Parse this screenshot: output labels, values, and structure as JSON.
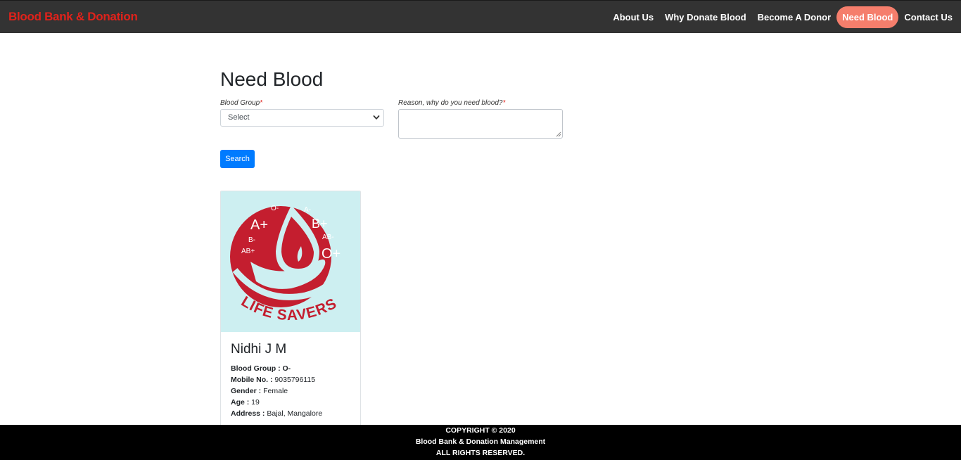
{
  "navbar": {
    "brand": "Blood Bank & Donation",
    "links": [
      {
        "label": "About Us"
      },
      {
        "label": "Why Donate Blood"
      },
      {
        "label": "Become A Donor"
      },
      {
        "label": "Need Blood",
        "active": true
      },
      {
        "label": "Contact Us"
      }
    ]
  },
  "main": {
    "title": "Need Blood",
    "blood_group_label": "Blood Group",
    "blood_group_value": "Select",
    "reason_label": "Reason, why do you need blood?",
    "reason_value": "",
    "required_mark": "*",
    "search_label": "Search"
  },
  "donor_card": {
    "image": {
      "logo_text": "LIFE SAVERS",
      "blood_types": [
        "A+",
        "O-",
        "A-",
        "B+",
        "B-",
        "AB-",
        "AB+",
        "O+"
      ]
    },
    "name": "Nidhi J M",
    "fields": [
      {
        "label": "Blood Group :",
        "value": "O-"
      },
      {
        "label": "Mobile No. :",
        "value": "9035796115"
      },
      {
        "label": "Gender :",
        "value": "Female"
      },
      {
        "label": "Age :",
        "value": "19"
      },
      {
        "label": "Address :",
        "value": "Bajal, Mangalore"
      }
    ]
  },
  "footer": {
    "line1": "COPYRIGHT © 2020",
    "line2": "Blood Bank & Donation Management",
    "line3": "ALL RIGHTS RESERVED."
  },
  "colors": {
    "navbar_bg": "#333333",
    "brand": "#e0221b",
    "active_link_bg": "#f57e6c",
    "primary_button": "#007bff",
    "logo_red": "#c41e2f",
    "logo_bg": "#cdeff1",
    "footer_bg": "#000000"
  }
}
